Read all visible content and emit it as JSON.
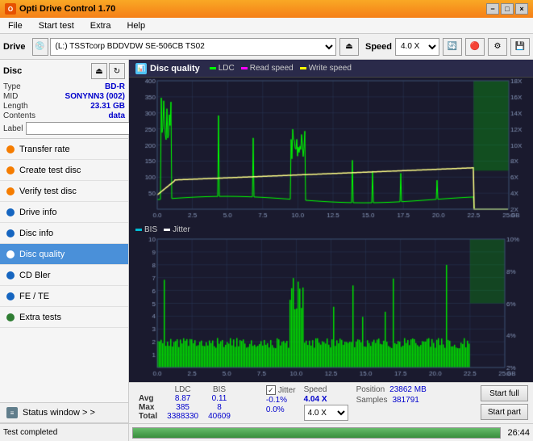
{
  "titlebar": {
    "title": "Opti Drive Control 1.70",
    "minimize": "−",
    "maximize": "□",
    "close": "×"
  },
  "menubar": {
    "items": [
      "File",
      "Start test",
      "Extra",
      "Help"
    ]
  },
  "toolbar": {
    "drive_label": "Drive",
    "drive_value": "(L:) TSSTcorp BDDVDW SE-506CB TS02",
    "speed_label": "Speed",
    "speed_value": "4.0 X"
  },
  "disc": {
    "title": "Disc",
    "type_label": "Type",
    "type_value": "BD-R",
    "mid_label": "MID",
    "mid_value": "SONYNN3 (002)",
    "length_label": "Length",
    "length_value": "23.31 GB",
    "contents_label": "Contents",
    "contents_value": "data",
    "label_label": "Label"
  },
  "nav": {
    "items": [
      {
        "id": "transfer-rate",
        "label": "Transfer rate",
        "icon_type": "orange"
      },
      {
        "id": "create-test-disc",
        "label": "Create test disc",
        "icon_type": "orange"
      },
      {
        "id": "verify-test-disc",
        "label": "Verify test disc",
        "icon_type": "orange"
      },
      {
        "id": "drive-info",
        "label": "Drive info",
        "icon_type": "blue"
      },
      {
        "id": "disc-info",
        "label": "Disc info",
        "icon_type": "blue"
      },
      {
        "id": "disc-quality",
        "label": "Disc quality",
        "icon_type": "blue",
        "active": true
      },
      {
        "id": "cd-bler",
        "label": "CD Bler",
        "icon_type": "blue"
      },
      {
        "id": "fe-te",
        "label": "FE / TE",
        "icon_type": "blue"
      },
      {
        "id": "extra-tests",
        "label": "Extra tests",
        "icon_type": "green"
      }
    ]
  },
  "status_window": {
    "label": "Status window > >"
  },
  "chart": {
    "title": "Disc quality",
    "legend": [
      {
        "label": "LDC",
        "color": "#00ff00"
      },
      {
        "label": "Read speed",
        "color": "#ff00ff"
      },
      {
        "label": "Write speed",
        "color": "#ffff00"
      }
    ],
    "legend_bottom": [
      {
        "label": "BIS",
        "color": "#00ffff"
      },
      {
        "label": "Jitter",
        "color": "#ffffff"
      }
    ],
    "top_y_left_max": 400,
    "top_y_right_max": "18X",
    "bottom_y_max": 10,
    "x_max": "25.0 GB"
  },
  "stats": {
    "headers": [
      "LDC",
      "BIS",
      "",
      "Jitter",
      "Speed",
      ""
    ],
    "avg_label": "Avg",
    "avg_ldc": "8.87",
    "avg_bis": "0.11",
    "avg_jitter": "-0.1%",
    "max_label": "Max",
    "max_ldc": "385",
    "max_bis": "8",
    "max_jitter": "0.0%",
    "total_label": "Total",
    "total_ldc": "3388330",
    "total_bis": "40609",
    "speed_label": "Speed",
    "speed_value": "4.04 X",
    "speed_dropdown": "4.0 X",
    "position_label": "Position",
    "position_value": "23862 MB",
    "samples_label": "Samples",
    "samples_value": "381791",
    "jitter_checked": true,
    "start_full_label": "Start full",
    "start_part_label": "Start part"
  },
  "progress": {
    "status_text": "Test completed",
    "percent": 100,
    "time": "26:44"
  }
}
